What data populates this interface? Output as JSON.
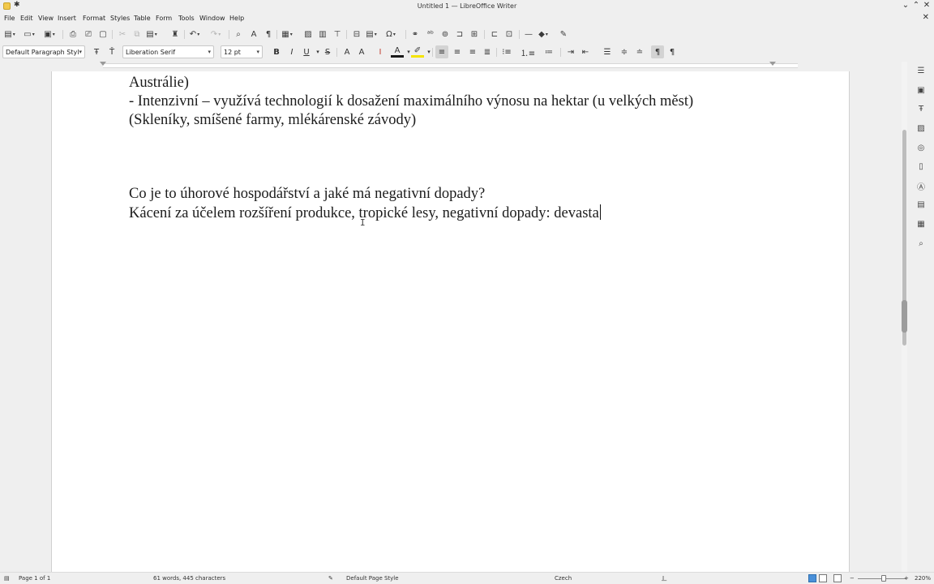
{
  "window": {
    "title": "Untitled 1 — LibreOffice Writer",
    "pin_icon": "✱",
    "minimize": "⌄",
    "maximize": "⌃",
    "close": "✕"
  },
  "menu": [
    "File",
    "Edit",
    "View",
    "Insert",
    "Format",
    "Styles",
    "Table",
    "Form",
    "Tools",
    "Window",
    "Help"
  ],
  "menu_close_icon": "✕",
  "formatting": {
    "paragraph_style": "Default Paragraph Styl",
    "font_name": "Liberation Serif",
    "font_size": "12 pt"
  },
  "document": {
    "lines": [
      "Austrálie)",
      "- Intenzivní – využívá technologií k dosažení maximálního výnosu na hektar (u velkých měst)",
      "(Skleníky, smíšené farmy, mlékárenské závody)",
      "Co je to úhorové hospodářství a jaké má negativní dopady?",
      "Kácení za účelem rozšíření produkce, tropické lesy, negativní dopady: devasta"
    ],
    "mouse_cursor": "I"
  },
  "status": {
    "page": "Page 1 of 1",
    "words": "61 words, 445 characters",
    "page_style": "Default Page Style",
    "language": "Czech",
    "zoom": "220%",
    "zoom_minus": "−",
    "zoom_plus": "+"
  },
  "colors": {
    "font_color": "#1a1a1a",
    "highlight": "#f5e400",
    "zoom_view_active": "#4a90d9"
  }
}
